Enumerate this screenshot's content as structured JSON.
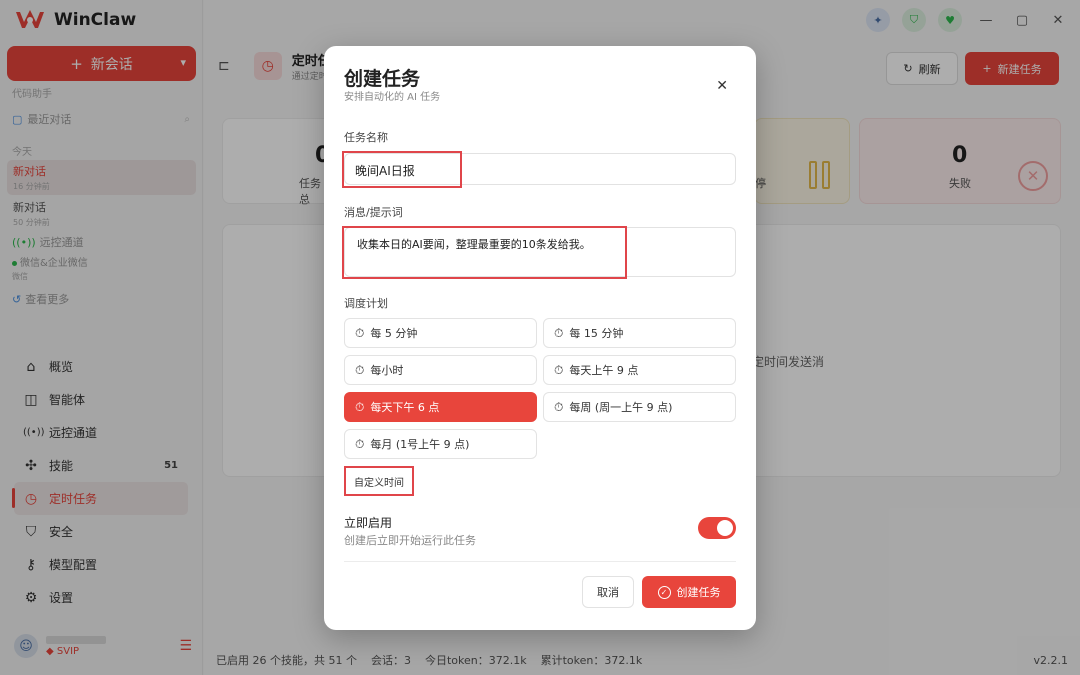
{
  "app": {
    "name": "WinClaw",
    "new_chat_label": "新会话",
    "sidebar_sub": "代码助手",
    "recent_label": "最近对话",
    "group_today": "今天",
    "conversations": [
      {
        "title": "新对话",
        "time": "16 分钟前"
      },
      {
        "title": "新对话",
        "time": "50 分钟前"
      }
    ],
    "remote_channel": "远控通道",
    "wechat_item": {
      "title": "微信&企业微信",
      "sub": "微信"
    },
    "view_more": "查看更多",
    "nav": [
      {
        "label": "概览",
        "icon": "home-icon"
      },
      {
        "label": "智能体",
        "icon": "robot-icon"
      },
      {
        "label": "远控通道",
        "icon": "broadcast-icon"
      },
      {
        "label": "技能",
        "icon": "puzzle-icon",
        "badge": "51"
      },
      {
        "label": "定时任务",
        "icon": "clock-icon",
        "active": true
      },
      {
        "label": "安全",
        "icon": "shield-icon"
      },
      {
        "label": "模型配置",
        "icon": "key-icon"
      },
      {
        "label": "设置",
        "icon": "gear-icon"
      }
    ],
    "user": {
      "vip": "SVIP"
    }
  },
  "main": {
    "page_title": "定时任",
    "page_sub": "通过定时",
    "refresh_label": "刷新",
    "new_task_label": "新建任务",
    "stats": [
      {
        "num": "0",
        "label": "任务总"
      },
      {
        "num": "",
        "label": "停"
      },
      {
        "num": "0",
        "label": "失败"
      }
    ],
    "empty_hint": "定时间发送消"
  },
  "statusbar": {
    "skills": "已启用 26 个技能，共 51 个",
    "sessions": "会话：3",
    "today_token": "今日token：372.1k",
    "total_token": "累计token：372.1k",
    "version": "v2.2.1"
  },
  "dialog": {
    "title": "创建任务",
    "subtitle": "安排自动化的 AI 任务",
    "name_label": "任务名称",
    "name_value": "晚间AI日报",
    "message_label": "消息/提示词",
    "message_value": "收集本日的AI要闻，整理最重要的10条发给我。",
    "schedule_label": "调度计划",
    "schedules": [
      {
        "label": "每 5 分钟",
        "selected": false
      },
      {
        "label": "每 15 分钟",
        "selected": false
      },
      {
        "label": "每小时",
        "selected": false
      },
      {
        "label": "每天上午 9 点",
        "selected": false
      },
      {
        "label": "每天下午 6 点",
        "selected": true
      },
      {
        "label": "每周 (周一上午 9 点)",
        "selected": false
      },
      {
        "label": "每月 (1号上午 9 点)",
        "selected": false
      }
    ],
    "custom_time_label": "自定义时间",
    "enable_title": "立即启用",
    "enable_desc": "创建后立即开始运行此任务",
    "enable_on": true,
    "cancel_label": "取消",
    "create_label": "创建任务"
  },
  "colors": {
    "accent": "#e8453c",
    "highlight_box": "#e0454a"
  }
}
